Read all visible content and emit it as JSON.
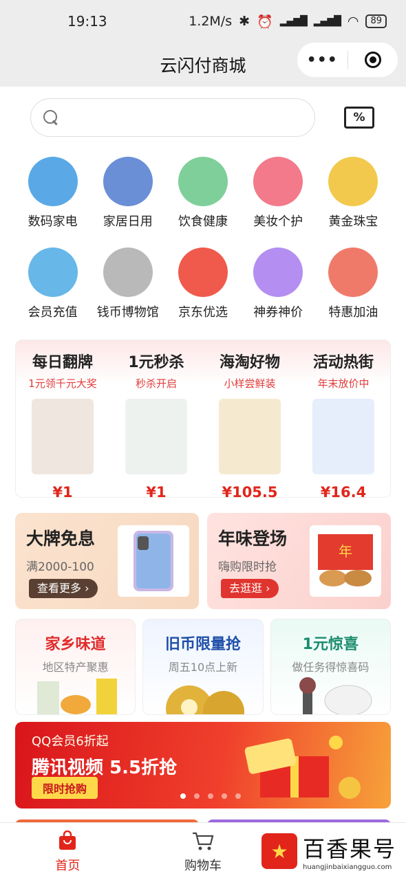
{
  "status_bar": {
    "time": "19:13",
    "speed": "1.2M/s",
    "battery": "89"
  },
  "nav": {
    "title": "云闪付商城",
    "more": "•••"
  },
  "search": {
    "placeholder": ""
  },
  "categories": [
    {
      "label": "数码家电",
      "color": "#5aa9e6",
      "icon": "phone-icon"
    },
    {
      "label": "家居日用",
      "color": "#6b8fd6",
      "icon": "tissue-icon"
    },
    {
      "label": "饮食健康",
      "color": "#7fcf9a",
      "icon": "health-icon"
    },
    {
      "label": "美妆个护",
      "color": "#f27a8a",
      "icon": "lipstick-icon"
    },
    {
      "label": "黄金珠宝",
      "color": "#f2c94c",
      "icon": "gold-icon"
    },
    {
      "label": "会员充值",
      "color": "#67b7e8",
      "icon": "membership-icon"
    },
    {
      "label": "钱币博物馆",
      "color": "#b9b9b9",
      "icon": "coin-icon"
    },
    {
      "label": "京东优选",
      "color": "#ef5a4c",
      "icon": "jd-dog-icon"
    },
    {
      "label": "神券神价",
      "color": "#b48ef0",
      "icon": "coupon-percent-icon"
    },
    {
      "label": "特惠加油",
      "color": "#f07a6a",
      "icon": "fuel-icon"
    }
  ],
  "promo": [
    {
      "title": "每日翻牌",
      "sub": "1元领千元大奖",
      "price": "¥1",
      "img_color": "#f0e6e0"
    },
    {
      "title": "1元秒杀",
      "sub": "秒杀开启",
      "price": "¥1",
      "img_color": "#eef2ee"
    },
    {
      "title": "海淘好物",
      "sub": "小样尝鲜装",
      "price": "¥105.5",
      "img_color": "#f5ead0"
    },
    {
      "title": "活动热街",
      "sub": "年末放价中",
      "price": "¥16.4",
      "img_color": "#e6eefc"
    }
  ],
  "duo": [
    {
      "title": "大牌免息",
      "sub": "满2000-100",
      "btn": "查看更多 ›"
    },
    {
      "title": "年味登场",
      "sub": "嗨购限时抢",
      "btn": "去逛逛 ›"
    }
  ],
  "trio": [
    {
      "title": "家乡味道",
      "sub": "地区特产聚惠"
    },
    {
      "title": "旧币限量抢",
      "sub": "周五10点上新"
    },
    {
      "title": "1元惊喜",
      "sub": "做任务得惊喜码"
    }
  ],
  "banner": {
    "sub": "QQ会员6折起",
    "title": "腾讯视频 5.5折抢",
    "btn": "限时抢购",
    "dots": 5,
    "active_dot": 0
  },
  "tabs": [
    {
      "label": "首页",
      "active": true
    },
    {
      "label": "购物车",
      "active": false
    }
  ],
  "watermark": {
    "name": "百香果号",
    "url": "huangjinbaixiangguo.com"
  }
}
